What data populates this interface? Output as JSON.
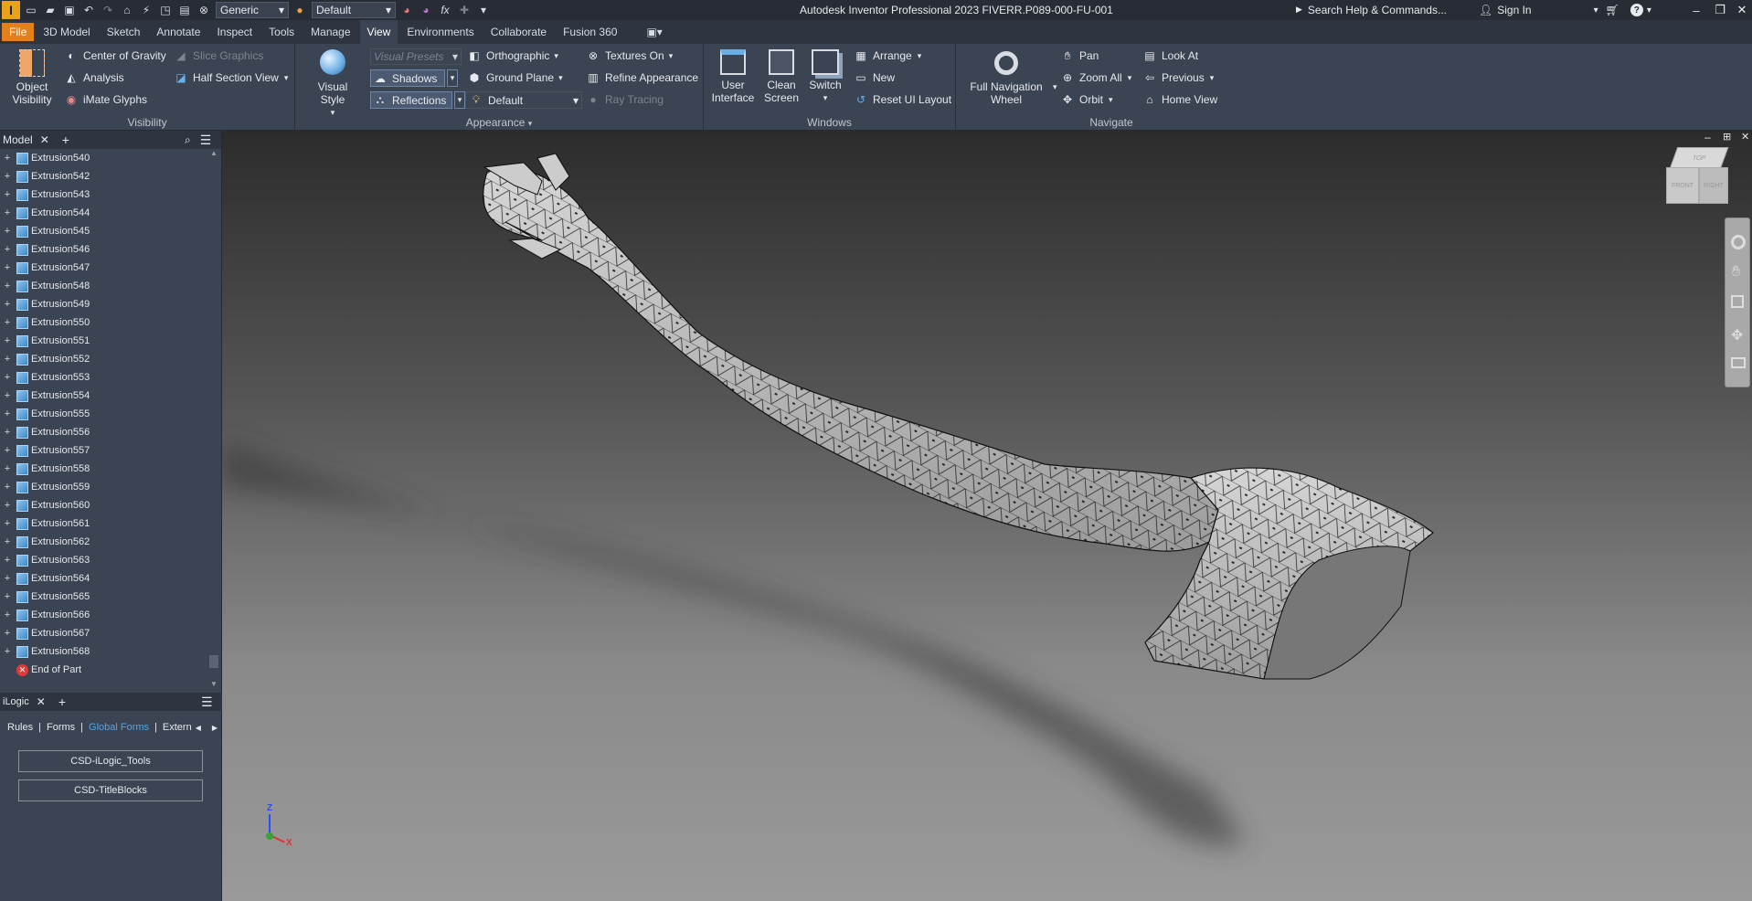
{
  "titlebar": {
    "logo": "I",
    "material": "Generic",
    "appearance": "Default",
    "title": "Autodesk Inventor Professional 2023    FIVERR.P089-000-FU-001",
    "search_placeholder": "Search Help & Commands...",
    "sign_in": "Sign In"
  },
  "tabs": [
    "File",
    "3D Model",
    "Sketch",
    "Annotate",
    "Inspect",
    "Tools",
    "Manage",
    "View",
    "Environments",
    "Collaborate",
    "Fusion 360"
  ],
  "ribbon": {
    "visibility": {
      "label": "Visibility",
      "object_visibility": "Object\nVisibility",
      "center_of_gravity": "Center of Gravity",
      "analysis": "Analysis",
      "imate_glyphs": "iMate Glyphs",
      "slice_graphics": "Slice Graphics",
      "half_section_view": "Half Section View"
    },
    "appearance": {
      "label": "Appearance",
      "visual_style": "Visual Style",
      "visual_presets": "Visual Presets",
      "shadows": "Shadows",
      "reflections": "Reflections",
      "orthographic": "Orthographic",
      "ground_plane": "Ground Plane",
      "lighting": "Default",
      "textures_on": "Textures On",
      "refine_appearance": "Refine Appearance",
      "ray_tracing": "Ray Tracing"
    },
    "windows": {
      "label": "Windows",
      "user_interface": "User\nInterface",
      "clean_screen": "Clean\nScreen",
      "switch": "Switch",
      "arrange": "Arrange",
      "new": "New",
      "reset_ui_layout": "Reset UI Layout"
    },
    "navigate": {
      "label": "Navigate",
      "full_navigation_wheel": "Full Navigation\nWheel",
      "pan": "Pan",
      "zoom_all": "Zoom All",
      "orbit": "Orbit",
      "look_at": "Look At",
      "previous": "Previous",
      "home_view": "Home View"
    }
  },
  "browser": {
    "tab": "Model",
    "items": [
      "Extrusion540",
      "Extrusion542",
      "Extrusion543",
      "Extrusion544",
      "Extrusion545",
      "Extrusion546",
      "Extrusion547",
      "Extrusion548",
      "Extrusion549",
      "Extrusion550",
      "Extrusion551",
      "Extrusion552",
      "Extrusion553",
      "Extrusion554",
      "Extrusion555",
      "Extrusion556",
      "Extrusion557",
      "Extrusion558",
      "Extrusion559",
      "Extrusion560",
      "Extrusion561",
      "Extrusion562",
      "Extrusion563",
      "Extrusion564",
      "Extrusion565",
      "Extrusion566",
      "Extrusion567",
      "Extrusion568"
    ],
    "end_of_part": "End of Part"
  },
  "ilogic": {
    "tab": "iLogic",
    "subtabs": [
      "Rules",
      "Forms",
      "Global Forms",
      "Extern"
    ],
    "buttons": [
      "CSD-iLogic_Tools",
      "CSD-TitleBlocks"
    ]
  },
  "viewcube": {
    "top": "TOP",
    "front": "FRONT",
    "right": "RIGHT"
  },
  "triad": {
    "z": "Z",
    "x": "X"
  },
  "colors": {
    "accent": "#e2811c",
    "active_tab_link": "#4ea6e8",
    "ribbon_bg": "#3b4453"
  }
}
